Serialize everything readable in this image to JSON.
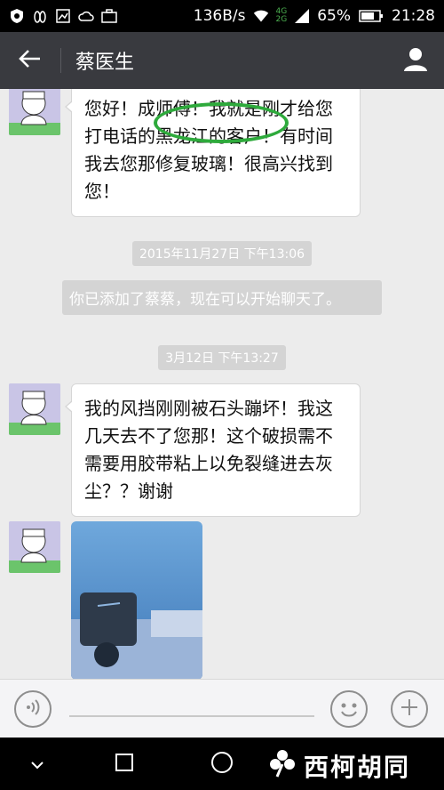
{
  "status_bar": {
    "network_speed": "136B/s",
    "net_tag_top": "4G",
    "net_tag_bottom": "2G",
    "battery": "65%",
    "time": "21:28"
  },
  "header": {
    "back_icon": "arrow-left-icon",
    "title": "蔡医生",
    "profile_icon": "person-icon"
  },
  "messages": [
    {
      "text": "您好！成师傅！我就是刚才给您打电话的黑龙江的客户！有时间我去您那修复玻璃！很高兴找到您！"
    },
    {
      "text": "我的风挡刚刚被石头蹦坏！我这几天去不了您那！这个破损需不需要用胶带粘上以免裂缝进去灰尘？？谢谢"
    }
  ],
  "timestamps": [
    "2015年11月27日 下午13:06",
    "3月12日 下午13:27"
  ],
  "system_message": "你已添加了蔡蔡，现在可以开始聊天了。",
  "input_bar": {
    "voice_icon": "voice-icon",
    "emoji_icon": "smiley-icon",
    "plus_icon": "plus-icon"
  },
  "watermark": "西柯胡同",
  "colors": {
    "header_bg": "#393a3f",
    "chat_bg": "#ececec",
    "highlight_circle": "#2eaa3c"
  }
}
